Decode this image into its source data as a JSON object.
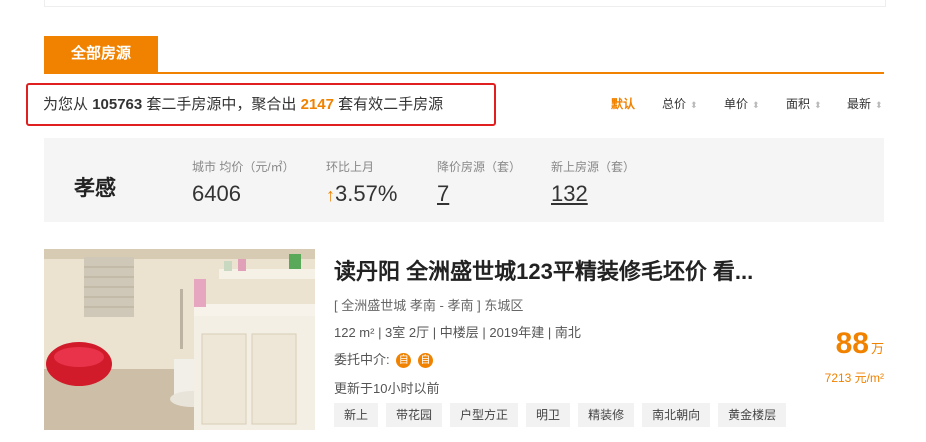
{
  "tab": {
    "label": "全部房源"
  },
  "summary": {
    "prefix": "为您从",
    "total": "105763",
    "middle": "套二手房源中，聚合出",
    "valid": "2147",
    "suffix": "套有效二手房源"
  },
  "sort": [
    {
      "label": "默认",
      "active": true
    },
    {
      "label": "总价"
    },
    {
      "label": "单价"
    },
    {
      "label": "面积"
    },
    {
      "label": "最新"
    }
  ],
  "city_stats": {
    "city": "孝感",
    "avg_price_label": "城市 均价（元/㎡）",
    "avg_price": "6406",
    "mom_label": "环比上月",
    "mom_value": "3.57%",
    "drop_label": "降价房源（套）",
    "drop_value": "7",
    "new_label": "新上房源（套）",
    "new_value": "132"
  },
  "listing": {
    "title": "读丹阳 全洲盛世城123平精装修毛坯价 看...",
    "loc_open": "[",
    "community": "全洲盛世城",
    "area": "孝南 - 孝南",
    "loc_close": "]",
    "district": "东城区",
    "info": "122 m² | 3室 2厅 | 中楼层 | 2019年建 | 南北",
    "agent_label": "委托中介:",
    "agent_badge": "自",
    "updated": "更新于10小时以前",
    "tags": [
      "新上",
      "带花园",
      "户型方正",
      "明卫",
      "精装修",
      "南北朝向",
      "黄金楼层"
    ],
    "price": "88",
    "price_unit": "万",
    "unit_price": "7213 元/m²"
  },
  "colors": {
    "accent": "#f08200",
    "highlight_border": "#e02020"
  }
}
